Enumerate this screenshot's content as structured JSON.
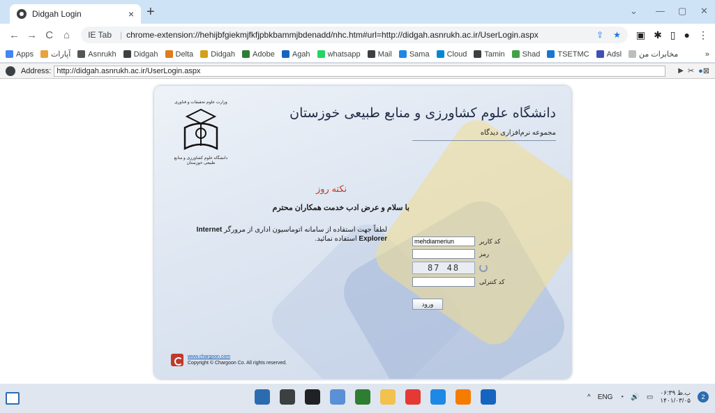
{
  "browser": {
    "tab_title": "Didgah Login",
    "tab_close": "×",
    "new_tab": "+",
    "window_controls": [
      "⌄",
      "—",
      "▢",
      "✕"
    ],
    "nav": {
      "back": "←",
      "forward": "→",
      "reload": "C",
      "home": "⌂"
    },
    "omnibox": {
      "ie_label": "IE Tab",
      "url": "chrome-extension://hehijbfgiekmjfkfjpbkbammjbdenadd/nhc.htm#url=http://didgah.asnrukh.ac.ir/UserLogin.aspx"
    },
    "bookmarks": [
      {
        "label": "Apps",
        "color": "#4285f4"
      },
      {
        "label": "آپارات",
        "color": "#e8a33d"
      },
      {
        "label": "Asnrukh",
        "color": "#555555"
      },
      {
        "label": "Didgah",
        "color": "#3c4043"
      },
      {
        "label": "Delta",
        "color": "#e07b1a"
      },
      {
        "label": "Didgah",
        "color": "#d4a017"
      },
      {
        "label": "Adobe",
        "color": "#2e7d32"
      },
      {
        "label": "Agah",
        "color": "#1565c0"
      },
      {
        "label": "whatsapp",
        "color": "#25d366"
      },
      {
        "label": "Mail",
        "color": "#3c4043"
      },
      {
        "label": "Sama",
        "color": "#1e88e5"
      },
      {
        "label": "Cloud",
        "color": "#0288d1"
      },
      {
        "label": "Tamin",
        "color": "#3c4043"
      },
      {
        "label": "Shad",
        "color": "#43a047"
      },
      {
        "label": "TSETMC",
        "color": "#1976d2"
      },
      {
        "label": "Adsl",
        "color": "#3f51b5"
      },
      {
        "label": "مخابرات من",
        "color": "#bdbdbd"
      }
    ],
    "bookmarks_more": "»"
  },
  "ie_strip": {
    "label": "Address:",
    "url": "http://didgah.asnrukh.ac.ir/UserLogin.aspx"
  },
  "login": {
    "logo_top_text": "وزارت علوم تحقیقات و فناوری",
    "logo_bottom_text": "دانشگاه علوم کشاورزی و منابع طبیعی خوزستان",
    "university_name": "دانشگاه علوم کشاورزی و منابع طبیعی خوزستان",
    "subtitle": "مجموعه نرم‌افزاری دیدگاه",
    "tip_title": "نکته روز",
    "greeting": "با سلام و عرض ادب خدمت همکاران محترم",
    "notice_prefix": "لطفاً جهت استفاده از سامانه اتوماسیون اداری از مرورگر",
    "notice_browser": "Internet Explorer",
    "notice_suffix": "استفاده نمائید.",
    "username_label": "کد کاربر",
    "username_value": "mehdiameriun",
    "password_label": "رمز",
    "captcha_text": "87 48",
    "control_code_label": "کد کنترلی",
    "login_button": "ورود",
    "footer_link": "www.chargoon.com",
    "copyright": "Copyright © Chargoon Co. All rights reserved."
  },
  "taskbar": {
    "apps": [
      {
        "name": "start",
        "color": "#2b6cb0"
      },
      {
        "name": "search",
        "color": "#3c4043"
      },
      {
        "name": "task-view",
        "color": "#202124"
      },
      {
        "name": "app-1",
        "color": "#5b8fd6"
      },
      {
        "name": "app-2",
        "color": "#2e7d32"
      },
      {
        "name": "file-explorer",
        "color": "#f2c14e"
      },
      {
        "name": "chrome",
        "color": "#e53935"
      },
      {
        "name": "photoshop",
        "color": "#1e88e5"
      },
      {
        "name": "app-3",
        "color": "#f57c00"
      },
      {
        "name": "word",
        "color": "#1565c0"
      }
    ],
    "tray_caret": "^",
    "language": "ENG",
    "wifi": "◔",
    "volume": "🔊",
    "battery": "▭",
    "time": "ب.ظ ۰۶:۳۹",
    "date": "۱۴۰۱/۰۳/۰۵",
    "notification_count": "2"
  }
}
